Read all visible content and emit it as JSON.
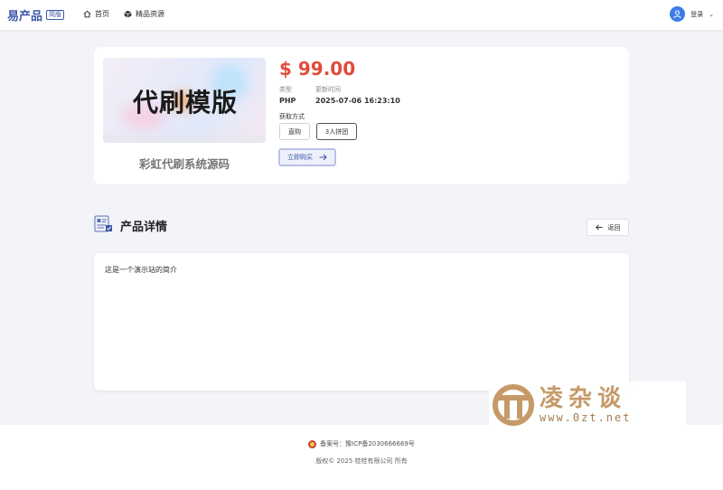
{
  "header": {
    "brand": "易产品",
    "badge": "简版",
    "nav": [
      {
        "label": "首页",
        "icon": "home-icon"
      },
      {
        "label": "精品资源",
        "icon": "cube-icon"
      }
    ],
    "user": {
      "label": "登录",
      "icon": "user-avatar-icon"
    }
  },
  "product": {
    "thumbnail_text": "代刷模版",
    "name": "彩虹代刷系统源码",
    "price": "$ 99.00",
    "type_label": "类型",
    "type_value": "PHP",
    "updated_label": "更新时间",
    "updated_value": "2025-07-06 16:23:10",
    "acquire_label": "获取方式",
    "options": [
      {
        "label": "直购",
        "selected": false
      },
      {
        "label": "3人拼团",
        "selected": true
      }
    ],
    "buy_label": "立即购买",
    "price_color": "#e24a3b"
  },
  "details": {
    "title": "产品详情",
    "back_label": "返回",
    "content": "这是一个演示站的简介"
  },
  "footer": {
    "icp": "备案号：豫ICP备2030666669号",
    "copyright": "版权© 2025 桂桂有限公司 所有"
  },
  "watermark": {
    "title": "凌杂谈",
    "url": "www.0zt.net"
  },
  "colors": {
    "brand": "#3d57a8",
    "accent_blue": "#3d7be6",
    "background": "#f3f4f8"
  }
}
